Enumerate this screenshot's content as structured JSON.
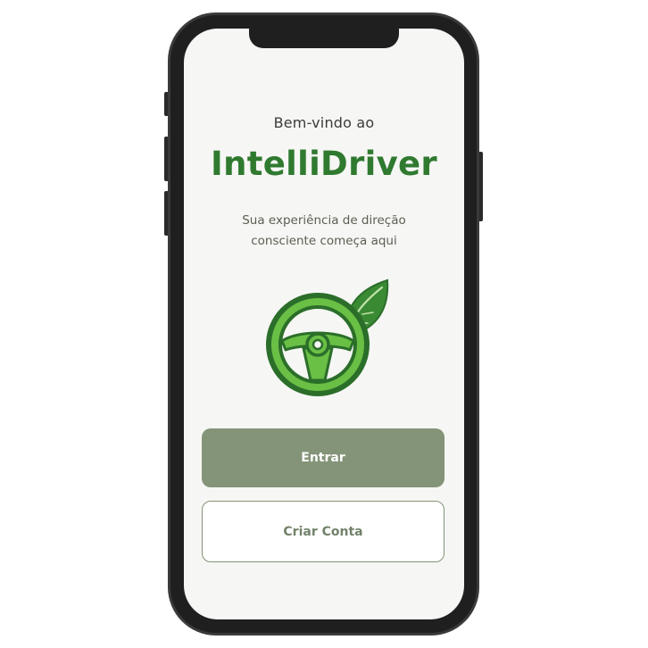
{
  "welcome": {
    "greeting": "Bem-vindo ao",
    "app_name": "IntelliDriver",
    "tagline_line1": "Sua experiência de direção",
    "tagline_line2": "consciente começa aqui"
  },
  "logo": {
    "icon": "steering-wheel-leaf-icon",
    "color_primary": "#2f7a2f",
    "color_light": "#6abf45"
  },
  "actions": {
    "login_label": "Entrar",
    "signup_label": "Criar Conta"
  },
  "colors": {
    "accent": "#849478",
    "brand_green": "#2f7a2f",
    "screen_bg": "#f6f6f4"
  }
}
